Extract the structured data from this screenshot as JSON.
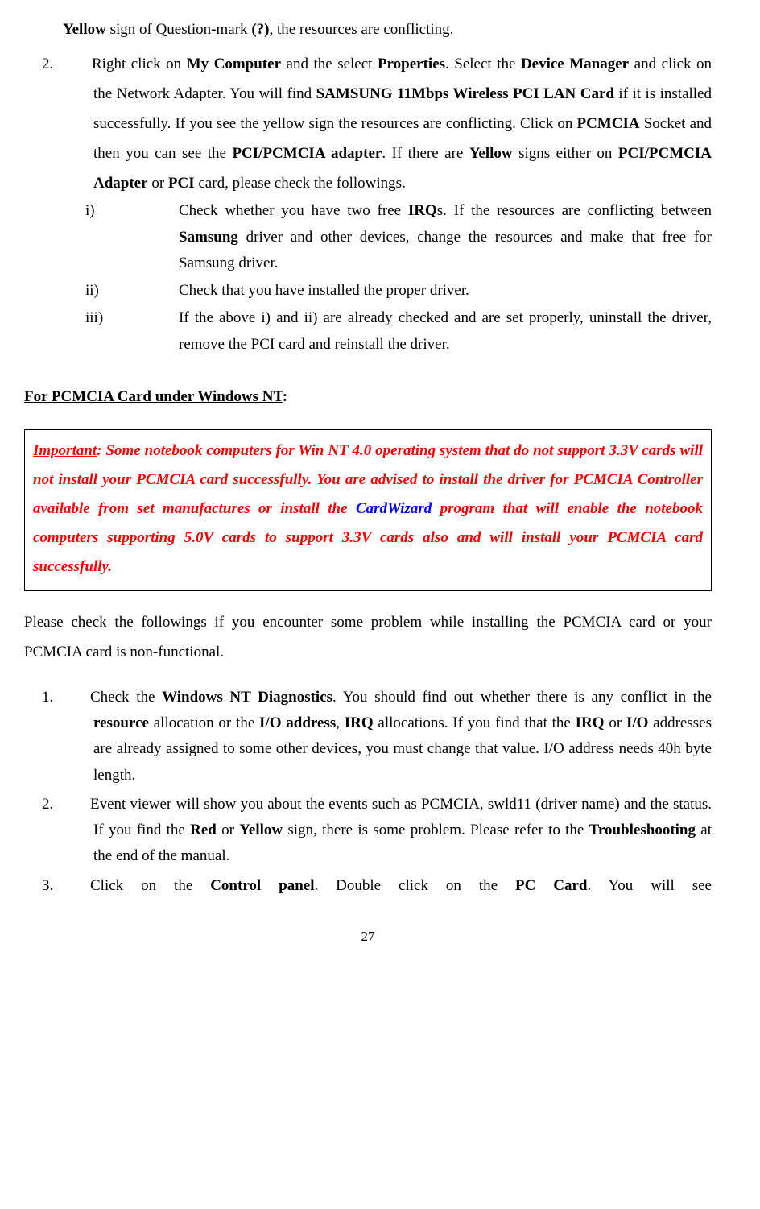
{
  "top": {
    "line1_a": "Yellow",
    "line1_b": " sign of Question-mark ",
    "line1_c": "(?)",
    "line1_d": ", the resources are conflicting."
  },
  "item2": {
    "marker": "2.",
    "t1": "Right click on ",
    "b1": "My Computer",
    "t2": " and the select ",
    "b2": "Properties",
    "t3": ". Select the ",
    "b3": "Device Manager",
    "t4": " and click on the Network Adapter. You will find ",
    "b4": "SAMSUNG 11Mbps Wireless PCI LAN Card",
    "t5": " if it is installed successfully. If you see the yellow sign the resources are conflicting. Click on ",
    "b5": "PCMCIA",
    "t6": " Socket and then you can see the ",
    "b6": "PCI/PCMCIA adapter",
    "t7": ". If there are ",
    "b7": "Yellow",
    "t8": " signs either on ",
    "b8": "PCI/PCMCIA Adapter",
    "t9": " or ",
    "b9": "PCI",
    "t10": " card, please check the followings."
  },
  "sub": {
    "i_m": "i)",
    "i_t1": "Check whether you have two free ",
    "i_b1": "IRQ",
    "i_t2": "s. If the resources are conflicting between ",
    "i_b2": "Samsung",
    "i_t3": " driver and other devices, change the resources and make that free for Samsung driver.",
    "ii_m": "ii)",
    "ii_t": "Check that you have installed the proper driver.",
    "iii_m": "iii)",
    "iii_t": "If the above i) and ii) are already checked and are set properly, uninstall the driver, remove the PCI card and reinstall the driver."
  },
  "heading": {
    "u": "For PCMCIA Card under Windows NT",
    "colon": ":"
  },
  "box": {
    "label": "Important",
    "t1": ": Some notebook computers for Win NT 4.0 operating system that do not support 3.3V cards will not install your PCMCIA card successfully. You are advised to install the driver for PCMCIA Controller available from set manufactures or install the ",
    "blue": "CardWizard",
    "t2": " program that will enable the notebook computers supporting 5.0V cards to support 3.3V cards also and will install your PCMCIA card successfully."
  },
  "para2": "Please check the followings if you encounter some problem while installing the PCMCIA card or your PCMCIA card is non-functional.",
  "nt": {
    "n1_m": "1.",
    "n1_t1": "Check the ",
    "n1_b1": "Windows NT Diagnostics",
    "n1_t2": ". You should find out whether there is any conflict in the ",
    "n1_b2": "resource",
    "n1_t3": " allocation or the ",
    "n1_b3": "I/O address",
    "n1_t4": ", ",
    "n1_b4": "IRQ",
    "n1_t5": " allocations. If you find that the ",
    "n1_b5": "IRQ",
    "n1_t6": " or ",
    "n1_b6": "I/O",
    "n1_t7": " addresses are already assigned to some other devices, you must change that value. I/O address needs 40h byte length.",
    "n2_m": "2.",
    "n2_t1": "Event viewer will show you about the events such as PCMCIA, swld11 (driver name) and the status. If you find the ",
    "n2_b1": "Red",
    "n2_t2": " or ",
    "n2_b2": "Yellow",
    "n2_t3": " sign, there is some problem. Please refer to the ",
    "n2_b3": "Troubleshooting",
    "n2_t4": " at the end of the manual.",
    "n3_m": "3.",
    "n3_t1": "Click on the ",
    "n3_b1": "Control panel",
    "n3_t2": ". Double click on the ",
    "n3_b2": "PC Card",
    "n3_t3": ". You will see"
  },
  "page": "27"
}
